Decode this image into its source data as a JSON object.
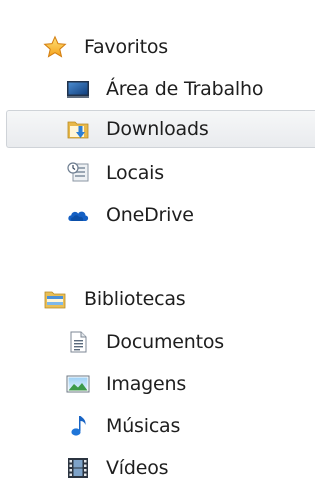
{
  "nav_pane": {
    "favorites": {
      "label": "Favoritos",
      "icon": "star-icon",
      "items": [
        {
          "label": "Área de Trabalho",
          "icon": "desktop-icon"
        },
        {
          "label": "Downloads",
          "icon": "downloads-folder-icon",
          "selected": true
        },
        {
          "label": "Locais",
          "icon": "recent-places-icon"
        },
        {
          "label": "OneDrive",
          "icon": "onedrive-cloud-icon"
        }
      ]
    },
    "libraries": {
      "label": "Bibliotecas",
      "icon": "libraries-icon",
      "items": [
        {
          "label": "Documentos",
          "icon": "document-icon"
        },
        {
          "label": "Imagens",
          "icon": "pictures-icon"
        },
        {
          "label": "Músicas",
          "icon": "music-note-icon"
        },
        {
          "label": "Vídeos",
          "icon": "film-icon"
        }
      ]
    }
  },
  "colors": {
    "selected_background": "#e9ebee",
    "selected_border": "#cfd3d8",
    "text": "#1e1e1e"
  }
}
